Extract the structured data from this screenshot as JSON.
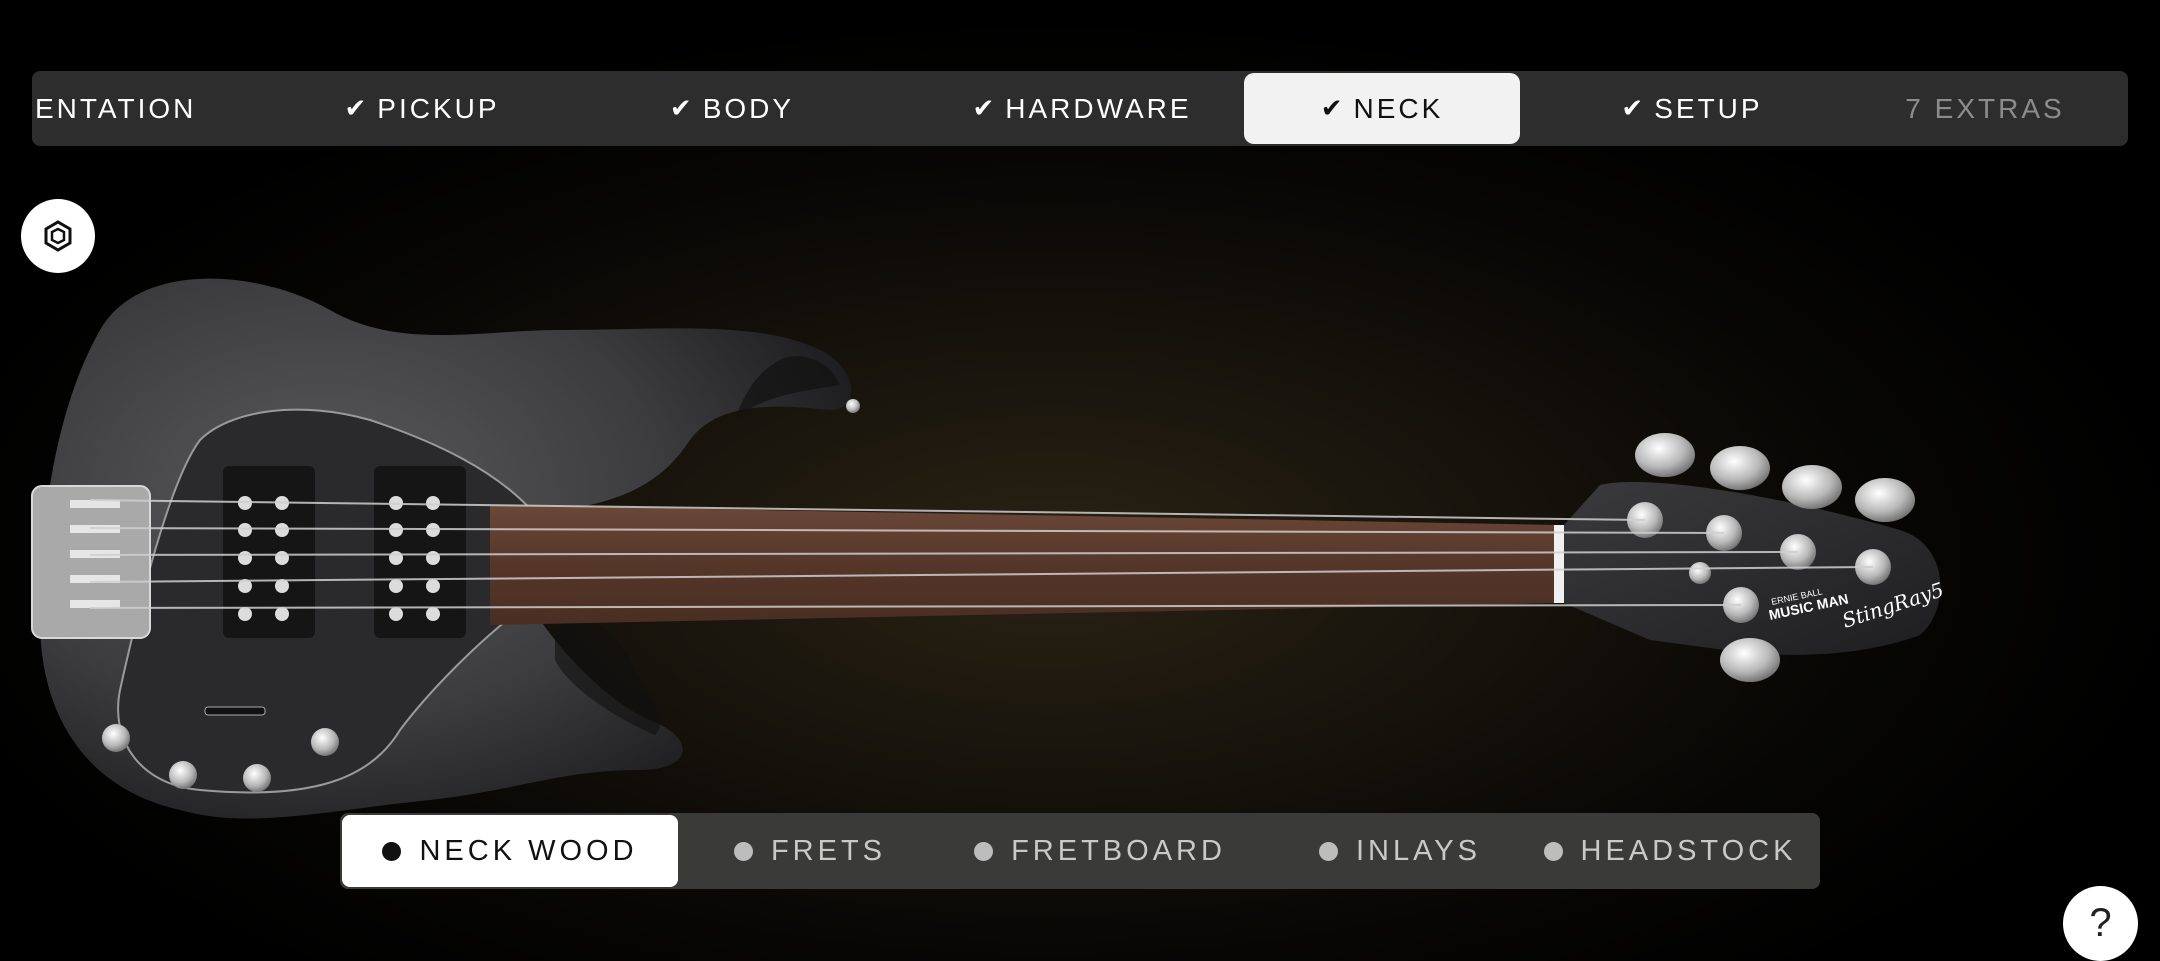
{
  "topnav": {
    "tabs": [
      {
        "label": "ENTATION",
        "checked": false,
        "state": "partial"
      },
      {
        "label": "PICKUP",
        "checked": true
      },
      {
        "label": "BODY",
        "checked": true
      },
      {
        "label": "HARDWARE",
        "checked": true
      },
      {
        "label": "NECK",
        "checked": true,
        "active": true
      },
      {
        "label": "SETUP",
        "checked": true
      },
      {
        "label": "7 EXTRAS",
        "checked": false,
        "state": "dim"
      }
    ],
    "check_glyph": "✔"
  },
  "subnav": {
    "tabs": [
      {
        "label": "NECK WOOD",
        "active": true
      },
      {
        "label": "FRETS"
      },
      {
        "label": "FRETBOARD"
      },
      {
        "label": "INLAYS"
      },
      {
        "label": "HEADSTOCK"
      }
    ]
  },
  "headstock_logo": {
    "brand": "MUSIC MAN",
    "maker": "ERNIE BALL",
    "model": "StingRay5"
  },
  "help_button": {
    "label": "?"
  },
  "icons": {
    "ar_button": "ar-cube-icon",
    "help_button": "question-icon",
    "check": "check-icon"
  },
  "colors": {
    "nav_bg": "#2d2d2d",
    "active_tab_bg": "#f2f2f2",
    "subnav_bg": "#3a3a38",
    "body_finish": "#3e3e40",
    "fretboard": "#5b3c30"
  }
}
